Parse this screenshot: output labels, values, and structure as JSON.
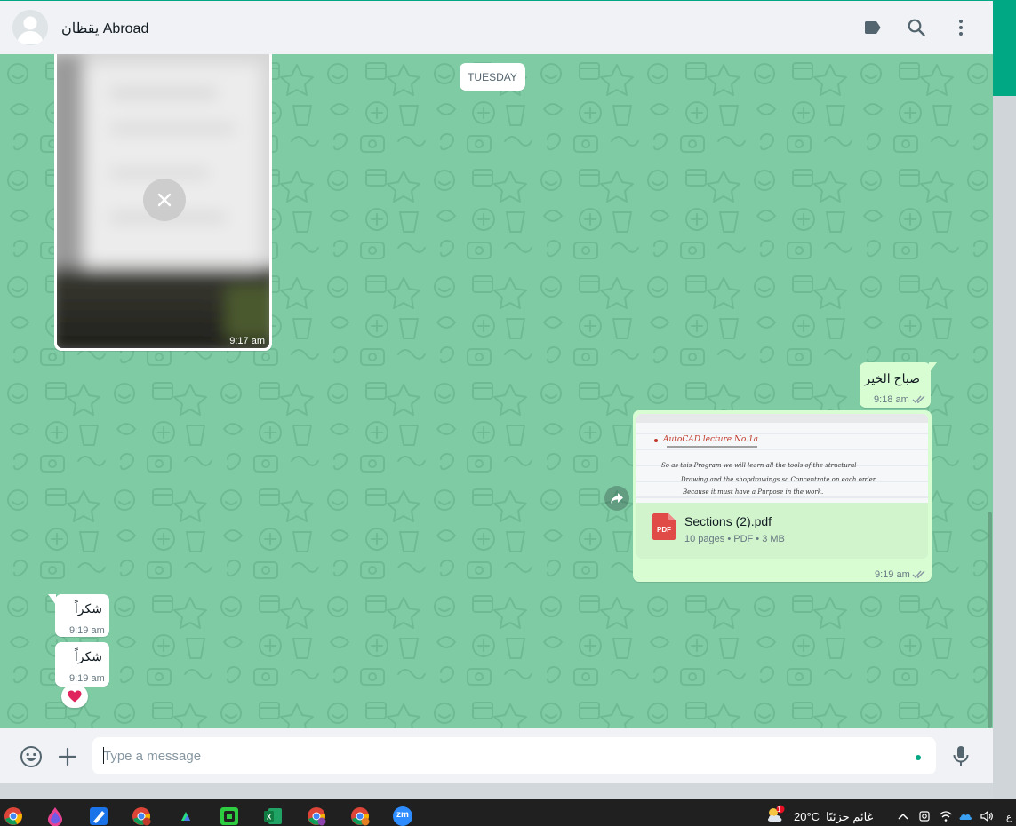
{
  "header": {
    "contact_name": "يقظان Abroad",
    "icons": [
      "avatar-icon",
      "label-icon",
      "search-icon",
      "menu-icon"
    ]
  },
  "chat": {
    "date_chip": "TUESDAY",
    "messages": [
      {
        "type": "image",
        "direction": "in",
        "time": "9:17 am",
        "status": "not downloaded"
      },
      {
        "type": "text",
        "direction": "out",
        "text": "صباح الخير",
        "time": "9:18 am",
        "ticks": "double-grey"
      },
      {
        "type": "document",
        "direction": "out",
        "file_name": "Sections (2).pdf",
        "meta": "10 pages • PDF • 3 MB",
        "time": "9:19 am",
        "ticks": "double-grey",
        "preview_lines": [
          "AutoCAD lecture No.1a",
          "So as this Program we will learn all the tools of the structural",
          "Drawing and the shopdrawings so Concentrate on each order",
          "Because it must have a Purpose in the work."
        ]
      },
      {
        "type": "text",
        "direction": "in",
        "text": "شكراً",
        "time": "9:19 am"
      },
      {
        "type": "text",
        "direction": "in",
        "text": "شكراً",
        "time": "9:19 am",
        "reaction": "❤️"
      }
    ]
  },
  "compose": {
    "placeholder": "Type a message",
    "value": ""
  },
  "taskbar": {
    "apps": [
      "chrome-icon",
      "paint-icon",
      "whiteboard-icon",
      "chrome-profile-icon",
      "filmora-icon",
      "camtasia-icon",
      "excel-icon",
      "chrome-profile-icon",
      "chrome-profile-icon",
      "zoom-icon"
    ],
    "zoom_label": "zm",
    "weather_temp": "20°C",
    "weather_condition": "غائم جزئيًا",
    "weather_badge": "1"
  },
  "colors": {
    "accent": "#00a884",
    "chat_bg": "#7fcba4",
    "bubble_out": "#d9fdd3",
    "bubble_in": "#ffffff"
  }
}
